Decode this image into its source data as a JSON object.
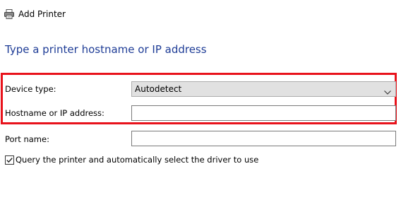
{
  "header": {
    "title": "Add Printer",
    "icon": "printer-icon"
  },
  "page": {
    "heading": "Type a printer hostname or IP address"
  },
  "form": {
    "device_type": {
      "label": "Device type:",
      "value": "Autodetect"
    },
    "hostname": {
      "label": "Hostname or IP address:",
      "value": ""
    },
    "port_name": {
      "label": "Port name:",
      "value": ""
    },
    "query_driver": {
      "label": "Query the printer and automatically select the driver to use",
      "checked": true
    }
  },
  "colors": {
    "heading": "#1e3c96",
    "highlight": "#e8121b",
    "select_background": "#e1e1e1"
  }
}
